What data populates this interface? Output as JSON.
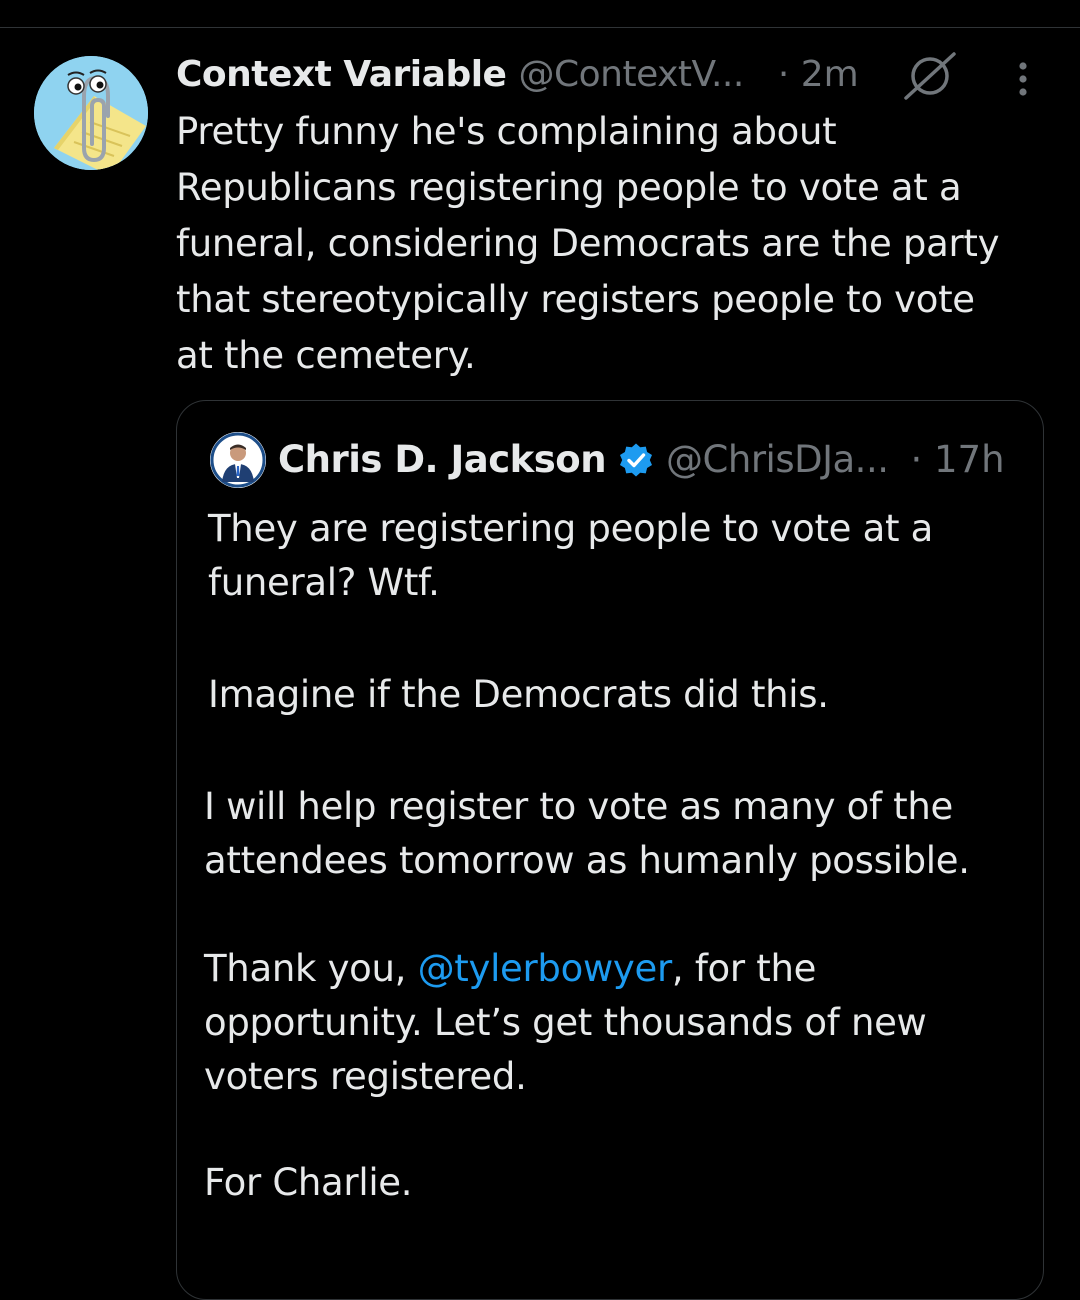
{
  "tweet": {
    "display_name": "Context Variable",
    "handle": "@ContextV...",
    "time": "· 2m",
    "icons": [
      "avatar-paperclip",
      "grok-icon",
      "more-icon"
    ],
    "text": "Pretty funny he's complaining about\nRepublicans registering people to vote at a\nfuneral, considering Democrats are the party\nthat stereotypically registers people to vote\nat the cemetery."
  },
  "quote": {
    "display_name": "Chris D. Jackson",
    "handle": "@ChrisDJa...",
    "time": "· 17h",
    "verified_icon": "verified-badge-icon",
    "verified_color": "#1d9bf0",
    "para1_line1": "They are registering people to vote at a",
    "para1_line2": "funeral? Wtf.",
    "para2": "Imagine if the Democrats did this.",
    "para3_line1": "I will help register to vote as many of the",
    "para3_line2": "attendees tomorrow as humanly possible.",
    "para4_prefix": "Thank you, ",
    "para4_mention": "@tylerbowyer",
    "para4_suffix": ", for the",
    "para4_line2": "opportunity. Let’s get thousands of new",
    "para4_line3": "voters registered.",
    "para5": "For Charlie."
  },
  "colors": {
    "background": "#000000",
    "text": "#e7e9ea",
    "secondary": "#71767b",
    "link": "#1d9bf0",
    "border": "#2f3336"
  }
}
